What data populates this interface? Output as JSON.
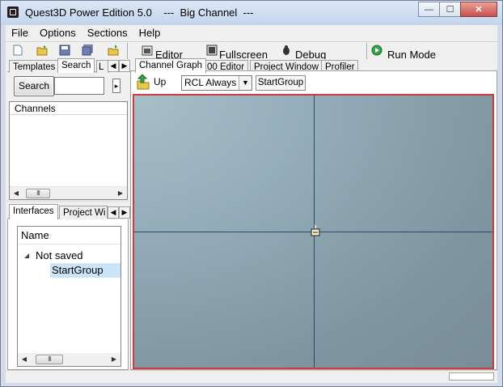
{
  "window": {
    "title": "Quest3D Power Edition 5.0    ---  Big Channel  ---",
    "buttons": {
      "minimize": "—",
      "maximize": "☐",
      "close": "✕"
    }
  },
  "menu": [
    "File",
    "Options",
    "Sections",
    "Help"
  ],
  "toolbar": {
    "editor_label": "Editor",
    "fullscreen_label": "Fullscreen",
    "debug_label": "Debug",
    "run_mode_label": "Run Mode"
  },
  "left_top_tabs": [
    "Templates",
    "Search",
    "L"
  ],
  "search": {
    "button_label": "Search",
    "value": ""
  },
  "channels": {
    "header": "Channels"
  },
  "scrollbar_thumb": "III",
  "left_bottom_tabs": [
    "Interfaces",
    "Project Wi"
  ],
  "tree": {
    "header": "Name",
    "root": {
      "label": "Not saved",
      "expander": "◢"
    },
    "child": {
      "label": "StartGroup",
      "selected": true
    }
  },
  "main_tabs": [
    "Channel Graph",
    "00 Editor",
    "Project Window",
    "Profiler"
  ],
  "graph_toolbar": {
    "up_label": "Up",
    "rcl_value": "RCL Always",
    "startgroup_label": "StartGroup"
  },
  "colors": {
    "canvas_border": "#d33a3a",
    "axis": "#2e4766",
    "canvas_bg": "#8ea6b1",
    "selection": "#cce4f7"
  },
  "icons": {
    "new": "new-document-icon",
    "open": "open-folder-icon",
    "save": "save-disk-icon",
    "up": "up-arrow-folder-icon"
  }
}
